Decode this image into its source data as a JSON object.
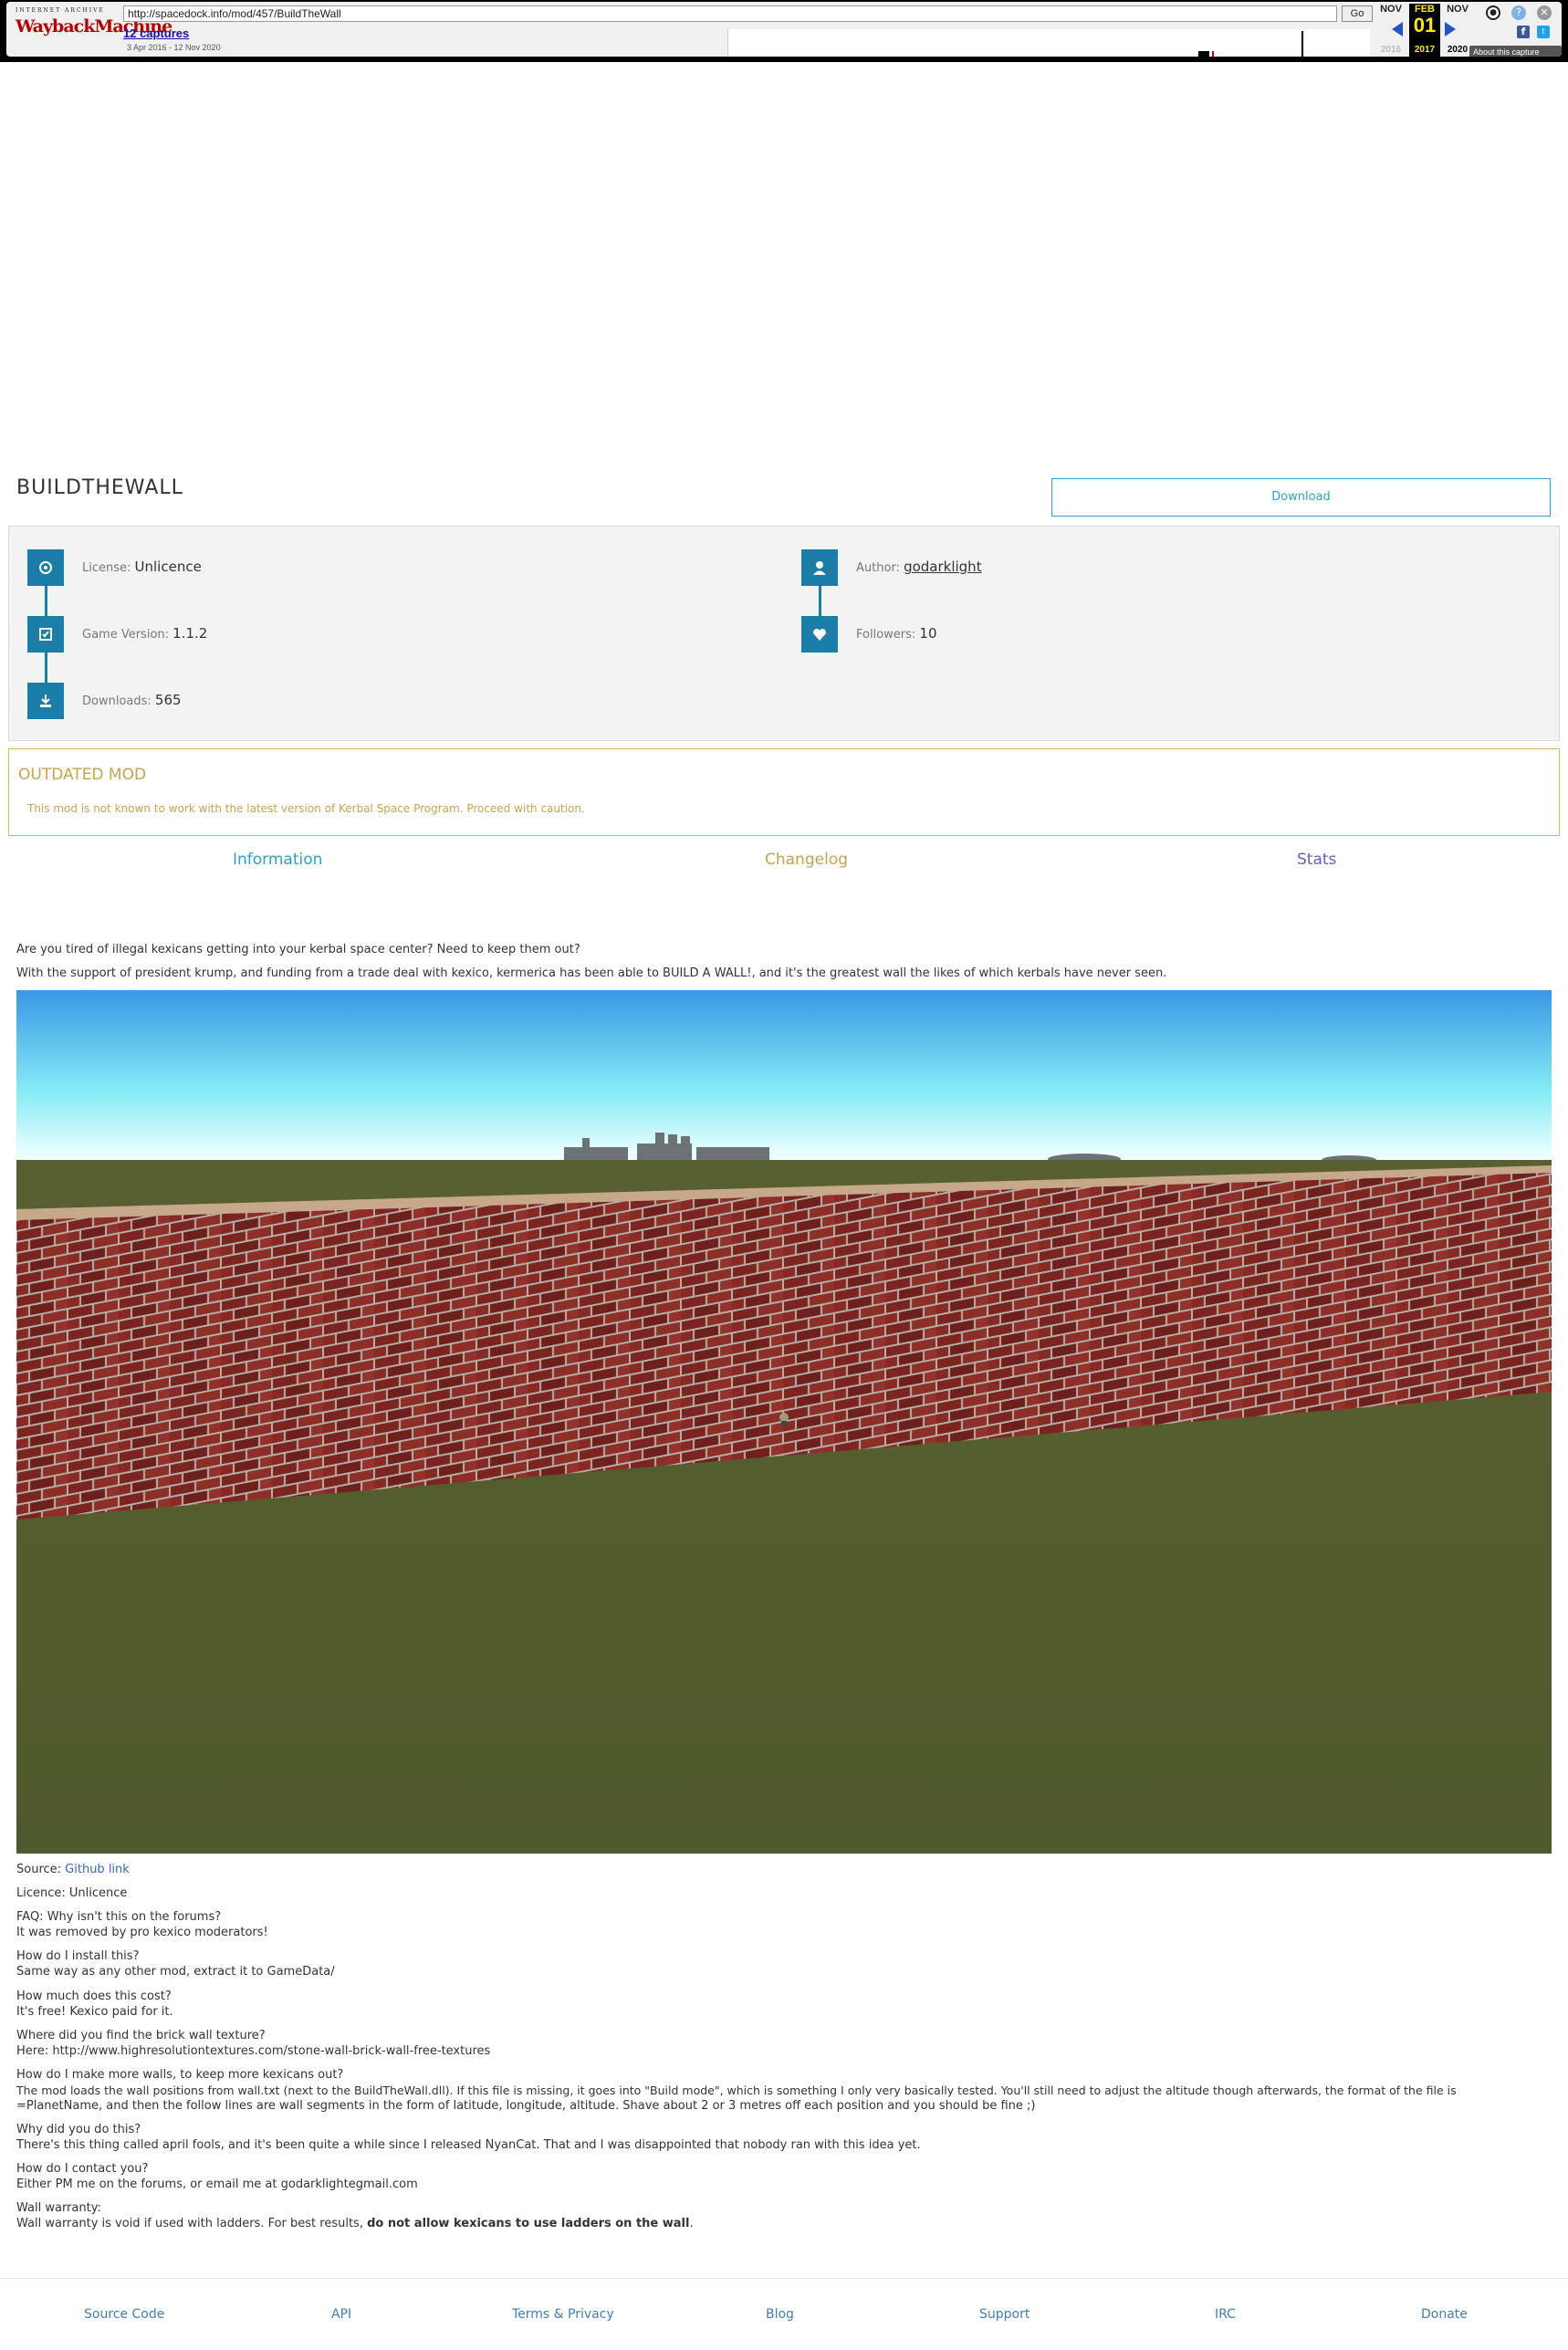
{
  "wayback": {
    "logo_top": "INTERNET ARCHIVE",
    "logo_main": "WaybackMachine",
    "url": "http://spacedock.info/mod/457/BuildTheWall",
    "go_label": "Go",
    "captures": "12 captures",
    "range": "3 Apr 2016 - 12 Nov 2020",
    "prev_month": "NOV",
    "prev_year": "2016",
    "cur_month": "FEB",
    "cur_day": "01",
    "cur_year": "2017",
    "next_month": "NOV",
    "next_year": "2020",
    "about": "About this capture",
    "icons": [
      "user-icon",
      "help-icon",
      "close-icon",
      "facebook-icon",
      "twitter-icon"
    ]
  },
  "mod": {
    "title": "BUILDTHEWALL",
    "download_label": "Download",
    "license_label": "License:",
    "license_value": "Unlicence",
    "game_version_label": "Game Version:",
    "game_version_value": "1.1.2",
    "downloads_label": "Downloads:",
    "downloads_value": "565",
    "author_label": "Author:",
    "author_value": "godarklight",
    "followers_label": "Followers:",
    "followers_value": "10",
    "icons": [
      "license-icon",
      "game-version-icon",
      "downloads-icon",
      "author-icon",
      "followers-icon"
    ]
  },
  "outdated": {
    "title": "OUTDATED MOD",
    "text": "This mod is not known to work with the latest version of Kerbal Space Program. Proceed with caution."
  },
  "tabs": [
    {
      "label": "Information",
      "color": "#2aa4c9"
    },
    {
      "label": "Changelog",
      "color": "#c8a34b"
    },
    {
      "label": "Stats",
      "color": "#6a5acd"
    }
  ],
  "description": {
    "intro1": "Are you tired of illegal kexicans getting into your kerbal space center? Need to keep them out?",
    "intro2": "With the support of president krump, and funding from a trade deal with kexico, kermerica has been able to BUILD A WALL!, and it's the greatest wall the likes of which kerbals have never seen.",
    "source_label": "Source:",
    "source_link": "Github link",
    "licence": "Licence: Unlicence",
    "faq1_q": "FAQ: Why isn't this on the forums?",
    "faq1_a": "It was removed by pro kexico moderators!",
    "faq2_q": "How do I install this?",
    "faq2_a": "Same way as any other mod, extract it to GameData/",
    "faq3_q": "How much does this cost?",
    "faq3_a": "It's free! Kexico paid for it.",
    "faq4_q": "Where did you find the brick wall texture?",
    "faq4_a": "Here: http://www.highresolutiontextures.com/stone-wall-brick-wall-free-textures",
    "faq5_q": "How do I make more walls, to keep more kexicans out?",
    "faq5_a1": "The mod loads the wall positions from wall.txt (next to the BuildTheWall.dll). If this file is missing, it goes into \"Build mode\", which is something I only very basically tested. You'll still need to adjust the altitude though afterwards, the format of the file is",
    "faq5_a2": "=PlanetName, and then the follow lines are wall segments in the form of latitude, longitude, altitude. Shave about 2 or 3 metres off each position and you should be fine ;)",
    "faq6_q": "Why did you do this?",
    "faq6_a": "There's this thing called april fools, and it's been quite a while since I released NyanCat. That and I was disappointed that nobody ran with this idea yet.",
    "faq7_q": "How do I contact you?",
    "faq7_a": "Either PM me on the forums, or email me at godarklightegmail.com",
    "faq8_q": "Wall warranty:",
    "faq8_a": "Wall warranty is void if used with ladders. For best results,",
    "faq8_bold": "do not allow kexicans to use ladders on the wall"
  },
  "footer": [
    "Source Code",
    "API",
    "Terms & Privacy",
    "Blog",
    "Support",
    "IRC",
    "Donate"
  ],
  "colors": {
    "accent": "#2aa4c9",
    "icon_box": "#1a7ea8",
    "warning": "#c8a34b",
    "link": "#3f7fc0"
  }
}
